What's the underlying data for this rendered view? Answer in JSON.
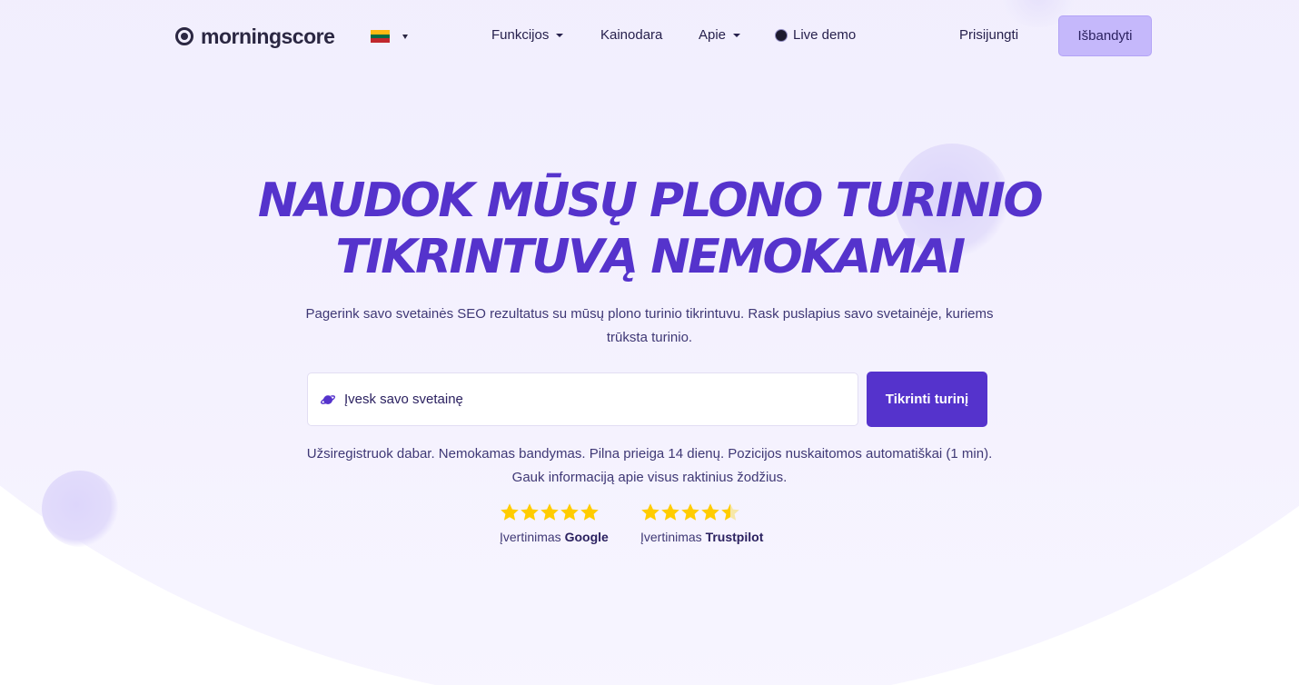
{
  "header": {
    "logo_text": "morningscore",
    "language": {
      "flag_colors": [
        "#fdb913",
        "#006a44",
        "#c1272d"
      ]
    },
    "nav": {
      "funkcijos": "Funkcijos",
      "kainodara": "Kainodara",
      "apie": "Apie",
      "live_demo": "Live demo"
    },
    "login": "Prisijungti",
    "try": "Išbandyti"
  },
  "hero": {
    "title_line1": "NAUDOK MŪSŲ PLONO TURINIO",
    "title_line2": "TIKRINTUVĄ NEMOKAMAI",
    "subtitle": "Pagerink savo svetainės SEO rezultatus su mūsų plono turinio tikrintuvu. Rask puslapius savo svetainėje, kuriems trūksta turinio.",
    "search_placeholder": "Įvesk savo svetainę",
    "check_button": "Tikrinti turinį",
    "note": "Užsiregistruok dabar. Nemokamas bandymas. Pilna prieiga 14 dienų. Pozicijos nuskaitomos automatiškai (1 min). Gauk informaciją apie visus raktinius žodžius."
  },
  "ratings": [
    {
      "prefix": "Įvertinimas",
      "source": "Google",
      "stars": 5
    },
    {
      "prefix": "Įvertinimas",
      "source": "Trustpilot",
      "stars": 4.5
    }
  ],
  "colors": {
    "accent": "#5533cc",
    "try_button": "#c5b8fb",
    "star": "#ffcc00",
    "star_empty": "#f6e7a8"
  }
}
